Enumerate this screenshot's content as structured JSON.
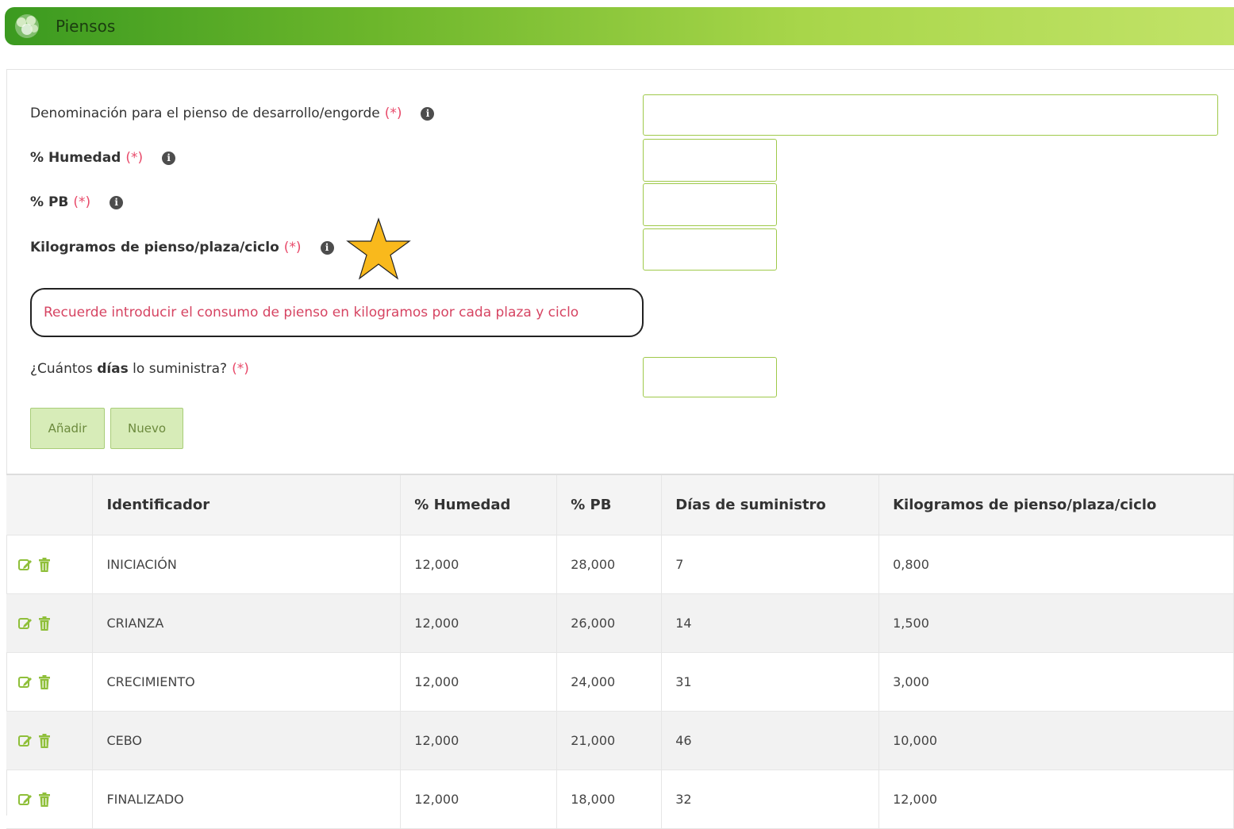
{
  "header": {
    "title": "Piensos"
  },
  "form": {
    "fields": [
      {
        "label": "Denominación para el pienso de desarrollo/engorde",
        "required": "(*)",
        "value": ""
      },
      {
        "label": "% Humedad",
        "required": "(*)",
        "value": ""
      },
      {
        "label": "% PB",
        "required": "(*)",
        "value": ""
      },
      {
        "label": "Kilogramos de pienso/plaza/ciclo",
        "required": "(*)",
        "value": ""
      }
    ],
    "note": "Recuerde introducir el consumo de pienso en kilogramos por cada plaza y ciclo",
    "days": {
      "label_pre": "¿Cuántos ",
      "label_bold": "días",
      "label_post": " lo suministra?",
      "required": "(*)",
      "value": ""
    },
    "buttons": {
      "add": "Añadir",
      "new": "Nuevo"
    }
  },
  "table": {
    "headers": [
      "Identificador",
      "% Humedad",
      "% PB",
      "Días de suministro",
      "Kilogramos de pienso/plaza/ciclo"
    ],
    "rows": [
      [
        "INICIACIÓN",
        "12,000",
        "28,000",
        "7",
        "0,800"
      ],
      [
        "CRIANZA",
        "12,000",
        "26,000",
        "14",
        "1,500"
      ],
      [
        "CRECIMIENTO",
        "12,000",
        "24,000",
        "31",
        "3,000"
      ],
      [
        "CEBO",
        "12,000",
        "21,000",
        "46",
        "10,000"
      ],
      [
        "FINALIZADO",
        "12,000",
        "18,000",
        "32",
        "12,000"
      ]
    ]
  },
  "colors": {
    "accent": "#6cb62b",
    "required": "#e84a6a",
    "star": "#f9b91c"
  }
}
